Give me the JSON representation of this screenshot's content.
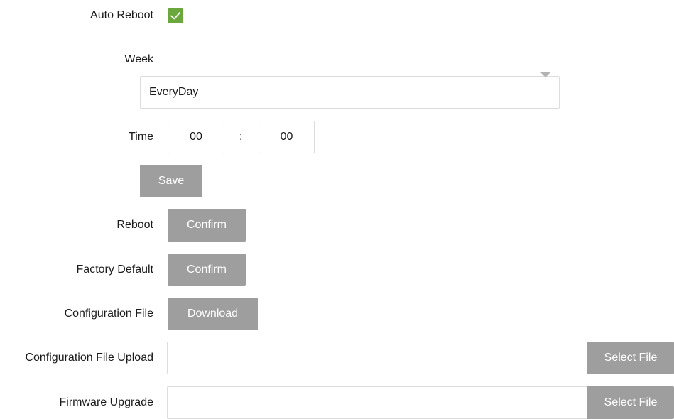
{
  "auto_reboot": {
    "label": "Auto Reboot",
    "checked": true,
    "check_color": "#6aa83d"
  },
  "week": {
    "label": "Week",
    "selected": "EveryDay"
  },
  "time": {
    "label": "Time",
    "hour": "00",
    "separator": ":",
    "minute": "00"
  },
  "save": {
    "label": "Save"
  },
  "reboot": {
    "label": "Reboot",
    "button": "Confirm"
  },
  "factory_default": {
    "label": "Factory Default",
    "button": "Confirm"
  },
  "configuration_file": {
    "label": "Configuration File",
    "button": "Download"
  },
  "configuration_upload": {
    "label": "Configuration File Upload",
    "button": "Select File"
  },
  "firmware_upgrade": {
    "label": "Firmware Upgrade",
    "button": "Select File"
  },
  "colors": {
    "button_gray": "#9e9e9e",
    "border": "#dcdcdc",
    "check_green": "#6aa83d"
  }
}
